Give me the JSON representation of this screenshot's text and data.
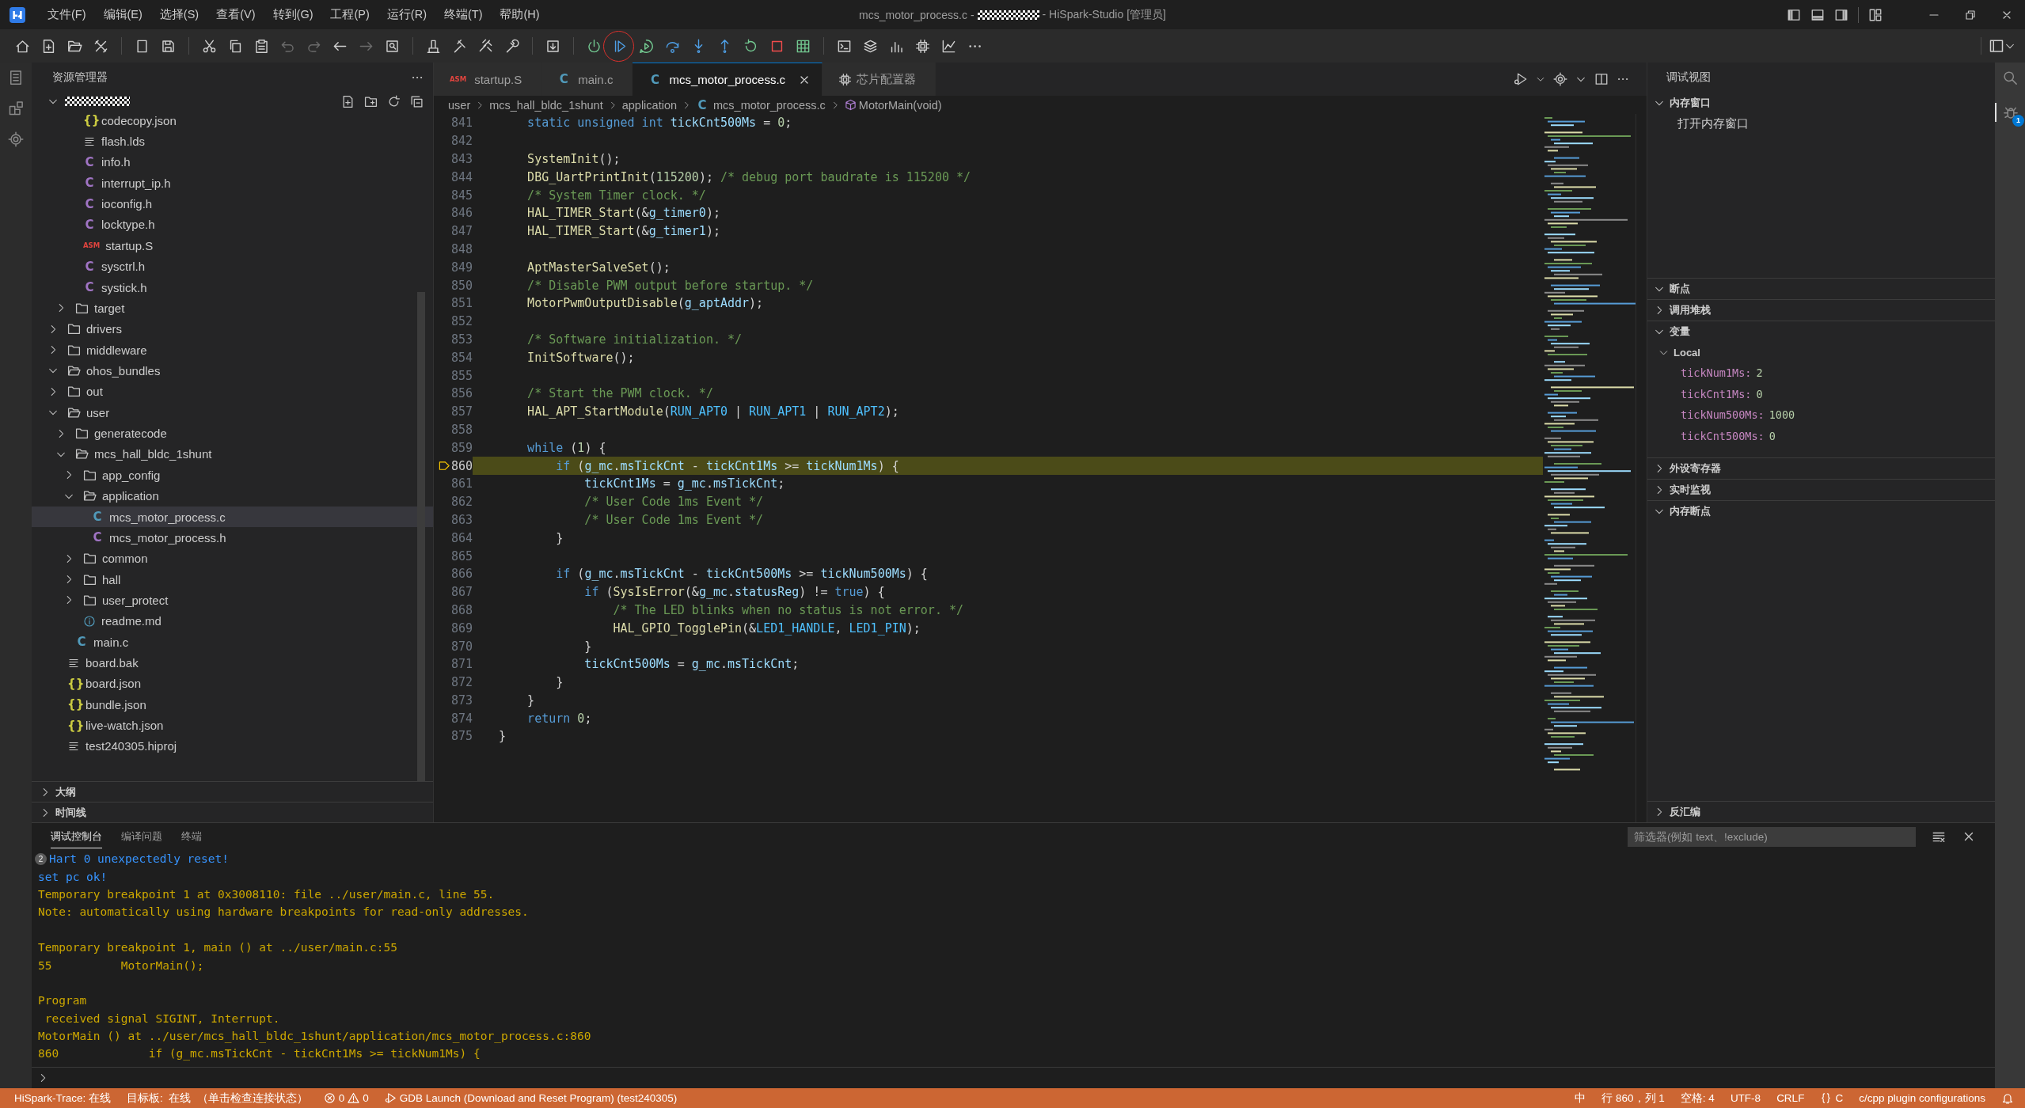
{
  "window": {
    "title_file": "mcs_motor_process.c -",
    "title_app": "- HiSpark-Studio [管理员]"
  },
  "menu": [
    "文件(F)",
    "编辑(E)",
    "选择(S)",
    "查看(V)",
    "转到(G)",
    "工程(P)",
    "运行(R)",
    "终端(T)",
    "帮助(H)"
  ],
  "explorer": {
    "title": "资源管理器",
    "tree": [
      {
        "children": [
          {
            "children": [
              {
                "label": "codecopy.json",
                "kind": "file",
                "icon": "{}",
                "color": "#cbcb41",
                "selected": false
              },
              {
                "label": "flash.lds",
                "kind": "doc",
                "selected": false
              },
              {
                "label": "info.h",
                "kind": "file",
                "icon": "C",
                "color": "#a074c4",
                "selected": false
              },
              {
                "label": "interrupt_ip.h",
                "kind": "file",
                "icon": "C",
                "color": "#a074c4",
                "selected": false
              },
              {
                "label": "ioconfig.h",
                "kind": "file",
                "icon": "C",
                "color": "#a074c4",
                "selected": false
              },
              {
                "label": "locktype.h",
                "kind": "file",
                "icon": "C",
                "color": "#a074c4",
                "selected": false
              },
              {
                "label": "startup.S",
                "kind": "file",
                "icon": "ASM",
                "color": "#e0443e",
                "selected": false
              },
              {
                "label": "sysctrl.h",
                "kind": "file",
                "icon": "C",
                "color": "#a074c4",
                "selected": false
              },
              {
                "label": "systick.h",
                "kind": "file",
                "icon": "C",
                "color": "#a074c4",
                "selected": false
              }
            ]
          },
          {
            "label": "target",
            "kind": "folder",
            "expanded": false,
            "selected": false
          }
        ]
      },
      {
        "label": "drivers",
        "kind": "folder",
        "expanded": false,
        "selected": false
      },
      {
        "label": "middleware",
        "kind": "folder",
        "expanded": false,
        "selected": false
      },
      {
        "label": "ohos_bundles",
        "kind": "folder",
        "expanded": true,
        "selected": false
      },
      {
        "label": "out",
        "kind": "folder",
        "expanded": false,
        "selected": false
      },
      {
        "label": "user",
        "kind": "folder",
        "expanded": true,
        "selected": false,
        "children": [
          {
            "label": "generatecode",
            "kind": "folder",
            "expanded": false,
            "selected": false
          },
          {
            "label": "mcs_hall_bldc_1shunt",
            "kind": "folder",
            "expanded": true,
            "selected": false,
            "children": [
              {
                "label": "app_config",
                "kind": "folder",
                "expanded": false,
                "selected": false
              },
              {
                "label": "application",
                "kind": "folder",
                "expanded": true,
                "selected": false,
                "children": [
                  {
                    "label": "mcs_motor_process.c",
                    "kind": "file",
                    "icon": "C",
                    "color": "#519aba",
                    "selected": true
                  },
                  {
                    "label": "mcs_motor_process.h",
                    "kind": "file",
                    "icon": "C",
                    "color": "#a074c4",
                    "selected": false
                  }
                ]
              },
              {
                "label": "common",
                "kind": "folder",
                "expanded": false,
                "selected": false
              },
              {
                "label": "hall",
                "kind": "folder",
                "expanded": false,
                "selected": false
              },
              {
                "label": "user_protect",
                "kind": "folder",
                "expanded": false,
                "selected": false
              },
              {
                "label": "readme.md",
                "kind": "info",
                "selected": false
              }
            ]
          },
          {
            "label": "main.c",
            "kind": "file",
            "icon": "C",
            "color": "#519aba",
            "selected": false
          }
        ]
      },
      {
        "label": "board.bak",
        "kind": "doc",
        "selected": false
      },
      {
        "label": "board.json",
        "kind": "file",
        "icon": "{}",
        "color": "#cbcb41",
        "selected": false
      },
      {
        "label": "bundle.json",
        "kind": "file",
        "icon": "{}",
        "color": "#cbcb41",
        "selected": false
      },
      {
        "label": "live-watch.json",
        "kind": "file",
        "icon": "{}",
        "color": "#cbcb41",
        "selected": false
      },
      {
        "label": "test240305.hiproj",
        "kind": "doc",
        "selected": false
      }
    ],
    "sections": [
      {
        "title": "大纲",
        "expanded": false
      },
      {
        "title": "时间线",
        "expanded": false
      }
    ]
  },
  "tabs": [
    {
      "label": "startup.S",
      "kind": "file",
      "icon": "ASM",
      "color": "#e0443e",
      "selected": false
    },
    {
      "label": "main.c",
      "kind": "file",
      "icon": "C",
      "color": "#519aba",
      "selected": false
    },
    {
      "label": "mcs_motor_process.c",
      "kind": "file",
      "icon": "C",
      "color": "#519aba",
      "selected": true
    },
    {
      "label": "芯片配置器",
      "kind": "chip",
      "selected": false
    }
  ],
  "breadcrumb": [
    {
      "label": "user",
      "kind": "folder"
    },
    {
      "label": "mcs_hall_bldc_1shunt",
      "kind": "folder"
    },
    {
      "label": "application",
      "kind": "folder"
    },
    {
      "label": "mcs_motor_process.c",
      "kind": "file",
      "icon": "C",
      "color": "#519aba"
    },
    {
      "label": "MotorMain(void)",
      "kind": "function"
    }
  ],
  "code": [
    {
      "number": "841",
      "current": false,
      "segments": [
        {
          "kind": "kw",
          "text": "    static unsigned int"
        },
        {
          "kind": "var",
          "text": " tickCnt500Ms"
        },
        {
          "kind": "p",
          "text": " = "
        },
        {
          "kind": "num",
          "text": "0"
        },
        {
          "kind": "p",
          "text": ";"
        }
      ]
    },
    {
      "number": "842",
      "current": false
    },
    {
      "number": "843",
      "current": false,
      "segments": [
        {
          "kind": "fn",
          "text": "    SystemInit"
        },
        {
          "kind": "p",
          "text": "();"
        }
      ]
    },
    {
      "number": "844",
      "current": false,
      "segments": [
        {
          "kind": "fn",
          "text": "    DBG_UartPrintInit"
        },
        {
          "kind": "p",
          "text": "("
        },
        {
          "kind": "num",
          "text": "115200"
        },
        {
          "kind": "p",
          "text": "); "
        },
        {
          "kind": "cm",
          "text": "/* debug port baudrate is 115200 */"
        }
      ]
    },
    {
      "number": "845",
      "current": false,
      "segments": [
        {
          "kind": "cm",
          "text": "    /* System Timer clock. */"
        }
      ]
    },
    {
      "number": "846",
      "current": false,
      "segments": [
        {
          "kind": "fn",
          "text": "    HAL_TIMER_Start"
        },
        {
          "kind": "p",
          "text": "(&"
        },
        {
          "kind": "var",
          "text": "g_timer0"
        },
        {
          "kind": "p",
          "text": ");"
        }
      ]
    },
    {
      "number": "847",
      "current": false,
      "segments": [
        {
          "kind": "fn",
          "text": "    HAL_TIMER_Start"
        },
        {
          "kind": "p",
          "text": "(&"
        },
        {
          "kind": "var",
          "text": "g_timer1"
        },
        {
          "kind": "p",
          "text": ");"
        }
      ]
    },
    {
      "number": "848",
      "current": false
    },
    {
      "number": "849",
      "current": false,
      "segments": [
        {
          "kind": "fn",
          "text": "    AptMasterSalveSet"
        },
        {
          "kind": "p",
          "text": "();"
        }
      ]
    },
    {
      "number": "850",
      "current": false,
      "segments": [
        {
          "kind": "cm",
          "text": "    /* Disable PWM output before startup. */"
        }
      ]
    },
    {
      "number": "851",
      "current": false,
      "segments": [
        {
          "kind": "fn",
          "text": "    MotorPwmOutputDisable"
        },
        {
          "kind": "p",
          "text": "("
        },
        {
          "kind": "var",
          "text": "g_aptAddr"
        },
        {
          "kind": "p",
          "text": ");"
        }
      ]
    },
    {
      "number": "852",
      "current": false
    },
    {
      "number": "853",
      "current": false,
      "segments": [
        {
          "kind": "cm",
          "text": "    /* Software initialization. */"
        }
      ]
    },
    {
      "number": "854",
      "current": false,
      "segments": [
        {
          "kind": "fn",
          "text": "    InitSoftware"
        },
        {
          "kind": "p",
          "text": "();"
        }
      ]
    },
    {
      "number": "855",
      "current": false
    },
    {
      "number": "856",
      "current": false,
      "segments": [
        {
          "kind": "cm",
          "text": "    /* Start the PWM clock. */"
        }
      ]
    },
    {
      "number": "857",
      "current": false,
      "segments": [
        {
          "kind": "fn",
          "text": "    HAL_APT_StartModule"
        },
        {
          "kind": "p",
          "text": "("
        },
        {
          "kind": "mac",
          "text": "RUN_APT0"
        },
        {
          "kind": "p",
          "text": " | "
        },
        {
          "kind": "mac",
          "text": "RUN_APT1"
        },
        {
          "kind": "p",
          "text": " | "
        },
        {
          "kind": "mac",
          "text": "RUN_APT2"
        },
        {
          "kind": "p",
          "text": ");"
        }
      ]
    },
    {
      "number": "858",
      "current": false
    },
    {
      "number": "859",
      "current": false,
      "segments": [
        {
          "kind": "kw",
          "text": "    while"
        },
        {
          "kind": "p",
          "text": " ("
        },
        {
          "kind": "num",
          "text": "1"
        },
        {
          "kind": "p",
          "text": ") {"
        }
      ]
    },
    {
      "number": "860",
      "current": true,
      "segments": [
        {
          "kind": "kw",
          "text": "        if"
        },
        {
          "kind": "p",
          "text": " ("
        },
        {
          "kind": "var",
          "text": "g_mc"
        },
        {
          "kind": "p",
          "text": "."
        },
        {
          "kind": "var",
          "text": "msTickCnt"
        },
        {
          "kind": "p",
          "text": " - "
        },
        {
          "kind": "var",
          "text": "tickCnt1Ms"
        },
        {
          "kind": "p",
          "text": " >= "
        },
        {
          "kind": "var",
          "text": "tickNum1Ms"
        },
        {
          "kind": "p",
          "text": ") {"
        }
      ]
    },
    {
      "number": "861",
      "current": false,
      "segments": [
        {
          "kind": "var",
          "text": "            tickCnt1Ms"
        },
        {
          "kind": "p",
          "text": " = "
        },
        {
          "kind": "var",
          "text": "g_mc"
        },
        {
          "kind": "p",
          "text": "."
        },
        {
          "kind": "var",
          "text": "msTickCnt"
        },
        {
          "kind": "p",
          "text": ";"
        }
      ]
    },
    {
      "number": "862",
      "current": false,
      "segments": [
        {
          "kind": "cm",
          "text": "            /* User Code 1ms Event */"
        }
      ]
    },
    {
      "number": "863",
      "current": false,
      "segments": [
        {
          "kind": "cm",
          "text": "            /* User Code 1ms Event */"
        }
      ]
    },
    {
      "number": "864",
      "current": false,
      "segments": [
        {
          "kind": "p",
          "text": "        }"
        }
      ]
    },
    {
      "number": "865",
      "current": false
    },
    {
      "number": "866",
      "current": false,
      "segments": [
        {
          "kind": "kw",
          "text": "        if"
        },
        {
          "kind": "p",
          "text": " ("
        },
        {
          "kind": "var",
          "text": "g_mc"
        },
        {
          "kind": "p",
          "text": "."
        },
        {
          "kind": "var",
          "text": "msTickCnt"
        },
        {
          "kind": "p",
          "text": " - "
        },
        {
          "kind": "var",
          "text": "tickCnt500Ms"
        },
        {
          "kind": "p",
          "text": " >= "
        },
        {
          "kind": "var",
          "text": "tickNum500Ms"
        },
        {
          "kind": "p",
          "text": ") {"
        }
      ]
    },
    {
      "number": "867",
      "current": false,
      "segments": [
        {
          "kind": "kw",
          "text": "            if"
        },
        {
          "kind": "p",
          "text": " ("
        },
        {
          "kind": "fn",
          "text": "SysIsError"
        },
        {
          "kind": "p",
          "text": "(&"
        },
        {
          "kind": "var",
          "text": "g_mc"
        },
        {
          "kind": "p",
          "text": "."
        },
        {
          "kind": "var",
          "text": "statusReg"
        },
        {
          "kind": "p",
          "text": ") != "
        },
        {
          "kind": "kw",
          "text": "true"
        },
        {
          "kind": "p",
          "text": ") {"
        }
      ]
    },
    {
      "number": "868",
      "current": false,
      "segments": [
        {
          "kind": "cm",
          "text": "                /* The LED blinks when no status is not error. */"
        }
      ]
    },
    {
      "number": "869",
      "current": false,
      "segments": [
        {
          "kind": "fn",
          "text": "                HAL_GPIO_TogglePin"
        },
        {
          "kind": "p",
          "text": "(&"
        },
        {
          "kind": "mac",
          "text": "LED1_HANDLE"
        },
        {
          "kind": "p",
          "text": ", "
        },
        {
          "kind": "mac",
          "text": "LED1_PIN"
        },
        {
          "kind": "p",
          "text": ");"
        }
      ]
    },
    {
      "number": "870",
      "current": false,
      "segments": [
        {
          "kind": "p",
          "text": "            }"
        }
      ]
    },
    {
      "number": "871",
      "current": false,
      "segments": [
        {
          "kind": "var",
          "text": "            tickCnt500Ms"
        },
        {
          "kind": "p",
          "text": " = "
        },
        {
          "kind": "var",
          "text": "g_mc"
        },
        {
          "kind": "p",
          "text": "."
        },
        {
          "kind": "var",
          "text": "msTickCnt"
        },
        {
          "kind": "p",
          "text": ";"
        }
      ]
    },
    {
      "number": "872",
      "current": false,
      "segments": [
        {
          "kind": "p",
          "text": "        }"
        }
      ]
    },
    {
      "number": "873",
      "current": false,
      "segments": [
        {
          "kind": "p",
          "text": "    }"
        }
      ]
    },
    {
      "number": "874",
      "current": false,
      "segments": [
        {
          "kind": "kw",
          "text": "    return"
        },
        {
          "kind": "num",
          "text": " 0"
        },
        {
          "kind": "p",
          "text": ";"
        }
      ]
    },
    {
      "number": "875",
      "current": false,
      "segments": [
        {
          "kind": "p",
          "text": "}"
        }
      ]
    }
  ],
  "debug_view": {
    "title": "调试视图",
    "sections": [
      {
        "title": "内存窗口",
        "expanded": true,
        "items": [
          "打开内存窗口"
        ]
      },
      {
        "title": "断点",
        "expanded": true
      },
      {
        "title": "调用堆栈",
        "expanded": false
      },
      {
        "title": "变量",
        "expanded": true,
        "scopes": [
          {
            "label": "Local",
            "expanded": true,
            "variables": [
              {
                "name": "tickNum1Ms:",
                "value": "2"
              },
              {
                "name": "tickCnt1Ms:",
                "value": "0"
              },
              {
                "name": "tickNum500Ms:",
                "value": "1000"
              },
              {
                "name": "tickCnt500Ms:",
                "value": "0"
              }
            ]
          }
        ]
      },
      {
        "title": "外设寄存器",
        "expanded": false
      },
      {
        "title": "实时监视",
        "expanded": false
      },
      {
        "title": "内存断点",
        "expanded": true
      },
      {
        "title": "反汇编",
        "expanded": false
      }
    ]
  },
  "activity_badge": "1",
  "panel": {
    "tabs": [
      {
        "label": "调试控制台",
        "selected": true
      },
      {
        "label": "编译问题",
        "selected": false
      },
      {
        "label": "终端",
        "selected": false
      }
    ],
    "filter": {
      "placeholder": "筛选器(例如 text、!exclude)"
    },
    "console": [
      {
        "kind": "info",
        "badge": "2",
        "text": "Hart 0 unexpectedly reset!"
      },
      {
        "kind": "info",
        "text": "set pc ok!"
      },
      {
        "kind": "out",
        "text": "Temporary breakpoint 1 at 0x3008110: file ../user/main.c, line 55."
      },
      {
        "kind": "out",
        "text": "Note: automatically using hardware breakpoints for read-only addresses."
      },
      {
        "kind": "blank"
      },
      {
        "kind": "out",
        "text": "Temporary breakpoint 1, main () at ../user/main.c:55"
      },
      {
        "kind": "out",
        "text": "55          MotorMain();"
      },
      {
        "kind": "blank"
      },
      {
        "kind": "out",
        "text": "Program"
      },
      {
        "kind": "out",
        "text": " received signal SIGINT, Interrupt."
      },
      {
        "kind": "out",
        "text": "MotorMain () at ../user/mcs_hall_bldc_1shunt/application/mcs_motor_process.c:860"
      },
      {
        "kind": "out",
        "text": "860             if (g_mc.msTickCnt - tickCnt1Ms >= tickNum1Ms) {"
      }
    ]
  },
  "status_bar": {
    "left": [
      {
        "kind": "text",
        "text": "HiSpark-Trace: 在线"
      },
      {
        "kind": "text",
        "text": "目标板:  在线  （单击检查连接状态）"
      },
      {
        "kind": "problems",
        "errors": "0",
        "warnings": "0"
      },
      {
        "kind": "launch",
        "text": "GDB Launch (Download and Reset Program) (test240305)"
      }
    ],
    "right": [
      {
        "kind": "text",
        "text": "中"
      },
      {
        "kind": "text",
        "text": "行 860，列 1"
      },
      {
        "kind": "text",
        "text": "空格: 4"
      },
      {
        "kind": "text",
        "text": "UTF-8"
      },
      {
        "kind": "text",
        "text": "CRLF"
      },
      {
        "kind": "language",
        "text": "C"
      },
      {
        "kind": "text",
        "text": "c/cpp plugin configurations"
      },
      {
        "kind": "notifications"
      }
    ]
  }
}
